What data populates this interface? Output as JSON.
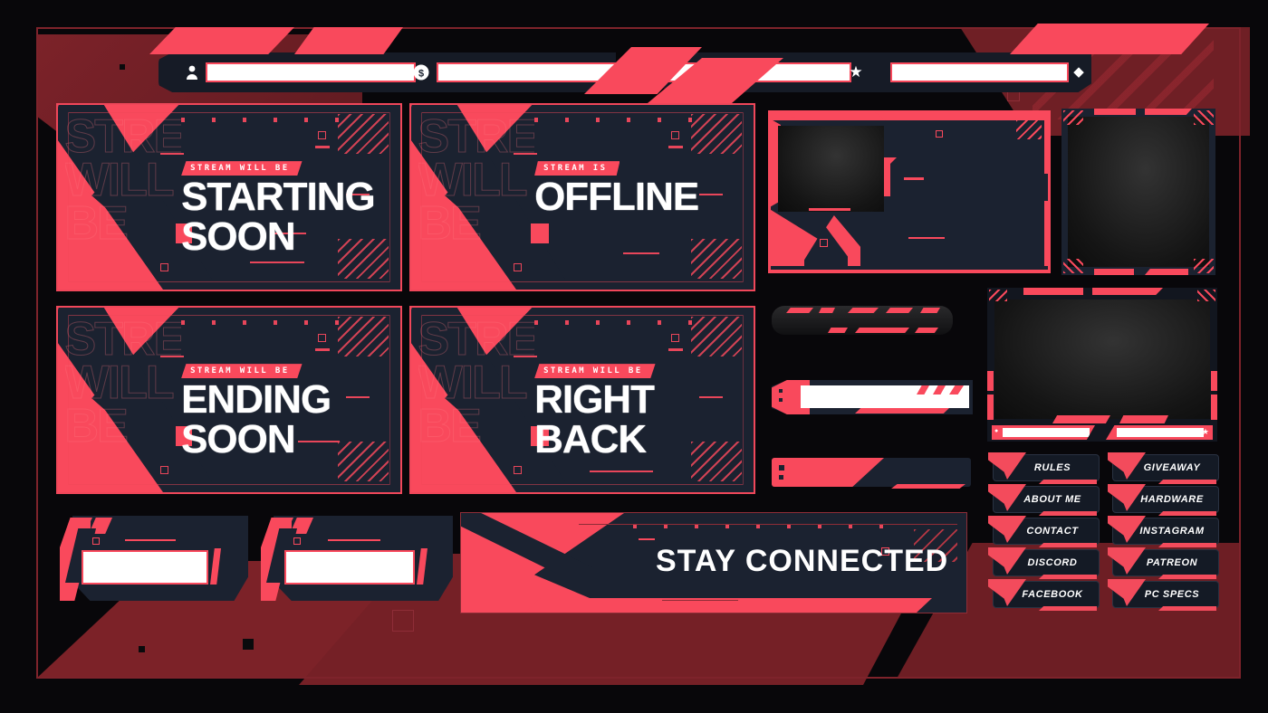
{
  "theme": {
    "accent_red": "#f9495c",
    "panel_navy": "#1b2230",
    "background_black": "#08070a",
    "maroon": "#7c2229",
    "white": "#ffffff"
  },
  "topbar": {
    "segments": [
      {
        "icon": "person-icon",
        "glyph": "\u0001",
        "field_value": ""
      },
      {
        "icon": "dollar-coin-icon",
        "glyph": "$",
        "field_value": ""
      },
      {
        "icon": "star-icon",
        "glyph": "★",
        "field_value": ""
      },
      {
        "icon": "diamond-icon",
        "glyph": "♦",
        "field_value": ""
      }
    ]
  },
  "scenes": [
    {
      "id": "starting-soon",
      "kicker": "STREAM WILL BE",
      "title_line1": "STARTING",
      "title_line2": "SOON",
      "ghost_text": "STREAM WILL BE"
    },
    {
      "id": "offline",
      "kicker": "STREAM IS",
      "title_line1": "OFFLINE",
      "title_line2": "",
      "ghost_text": "STREAM WILL BE"
    },
    {
      "id": "ending-soon",
      "kicker": "STREAM WILL BE",
      "title_line1": "ENDING",
      "title_line2": "SOON",
      "ghost_text": "STREAM WILL BE"
    },
    {
      "id": "right-back",
      "kicker": "STREAM WILL BE",
      "title_line1": "RIGHT",
      "title_line2": "BACK",
      "ghost_text": "STREAM WILL BE"
    }
  ],
  "webcam_frames": [
    {
      "id": "webcam-frame-wide",
      "label": ""
    },
    {
      "id": "webcam-frame-square",
      "label": ""
    },
    {
      "id": "webcam-frame-main",
      "label": ""
    }
  ],
  "bars": [
    {
      "id": "alert-bar-rounded",
      "value": ""
    },
    {
      "id": "label-bar-white",
      "value": ""
    },
    {
      "id": "label-bar-red",
      "value": ""
    }
  ],
  "lower_overlays": [
    {
      "id": "lower-third-left",
      "value": ""
    },
    {
      "id": "lower-third-right",
      "value": ""
    }
  ],
  "stay_connected": {
    "title": "STAY CONNECTED"
  },
  "panels": {
    "items": [
      {
        "label": "RULES"
      },
      {
        "label": "GIVEAWAY"
      },
      {
        "label": "ABOUT ME"
      },
      {
        "label": "HARDWARE"
      },
      {
        "label": "CONTACT"
      },
      {
        "label": "INSTAGRAM"
      },
      {
        "label": "DISCORD"
      },
      {
        "label": "PATREON"
      },
      {
        "label": "FACEBOOK"
      },
      {
        "label": "PC SPECS"
      }
    ]
  }
}
